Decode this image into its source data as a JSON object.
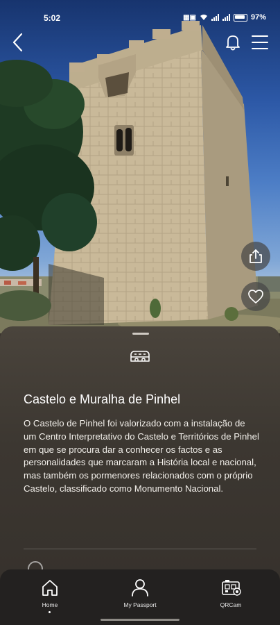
{
  "status_bar": {
    "time": "5:02",
    "battery": "97%"
  },
  "hero": {
    "image": "castle-tower-photo"
  },
  "actions": {
    "share_icon": "share-icon",
    "favorite_icon": "heart-icon"
  },
  "sheet": {
    "category_icon": "castle-icon",
    "title": "Castelo e Muralha de Pinhel",
    "description": "O Castelo de Pinhel foi valorizado com a instalação de um Centro Interpretativo do Castelo e Territórios de Pinhel em que se procura dar a conhecer os factos e as personalidades que marcaram a História local e nacional, mas também os pormenores relacionados com o próprio Castelo, classificado como Monumento Nacional."
  },
  "tabs": [
    {
      "label": "Home",
      "icon": "home-icon",
      "active": true
    },
    {
      "label": "My Passport",
      "icon": "person-icon",
      "active": false
    },
    {
      "label": "QRCam",
      "icon": "qr-camera-icon",
      "active": false
    }
  ],
  "colors": {
    "sheet": "#3c3731",
    "tabbar": "#232120",
    "text": "#ffffff"
  }
}
